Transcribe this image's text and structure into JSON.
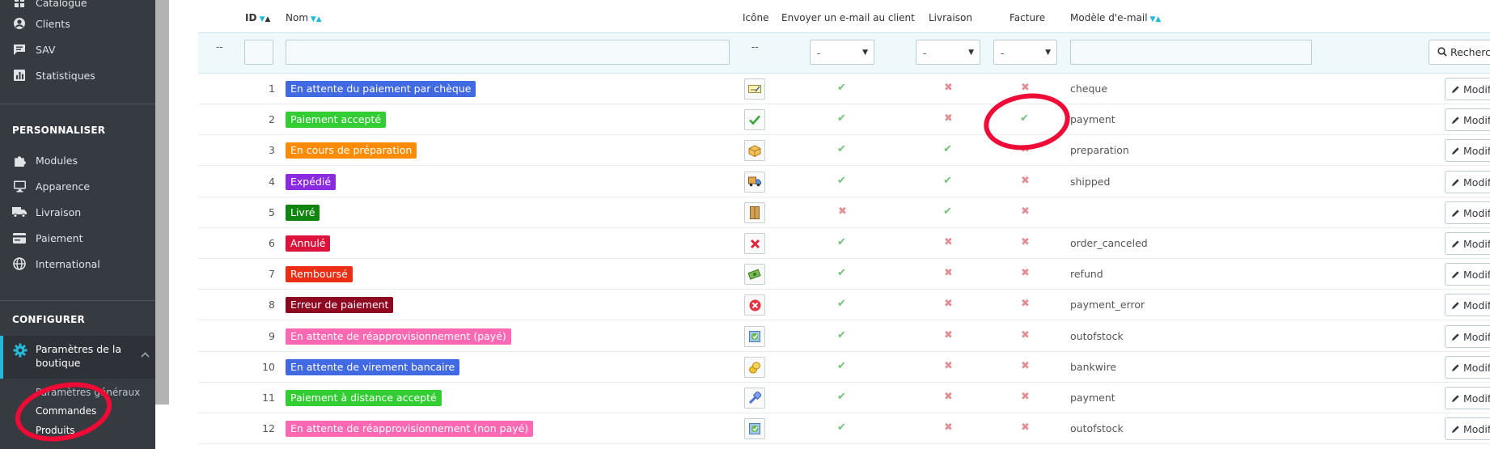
{
  "sidebar": {
    "top_items": [
      {
        "label": "Catalogue",
        "icon": "store-icon"
      },
      {
        "label": "Clients",
        "icon": "user-icon"
      },
      {
        "label": "SAV",
        "icon": "chat-icon"
      },
      {
        "label": "Statistiques",
        "icon": "chart-icon"
      }
    ],
    "section_customize": "PERSONNALISER",
    "customize_items": [
      {
        "label": "Modules",
        "icon": "puzzle-icon"
      },
      {
        "label": "Apparence",
        "icon": "monitor-icon"
      },
      {
        "label": "Livraison",
        "icon": "truck-icon"
      },
      {
        "label": "Paiement",
        "icon": "credit-card-icon"
      },
      {
        "label": "International",
        "icon": "globe-icon"
      }
    ],
    "section_configure": "CONFIGURER",
    "active_item": {
      "label": "Paramètres de la boutique",
      "icon": "gear-icon"
    },
    "sub_items": [
      "Paramètres généraux",
      "Commandes",
      "Produits"
    ]
  },
  "table": {
    "headers": {
      "id": "ID",
      "name": "Nom",
      "icon": "Icône",
      "send_email": "Envoyer un e-mail au client",
      "delivery": "Livraison",
      "invoice": "Facture",
      "template": "Modèle d'e-mail"
    },
    "filter": {
      "dash": "--",
      "select_placeholder": "-",
      "search_label": "Rechercher"
    },
    "edit_label": "Modifier",
    "rows": [
      {
        "id": "1",
        "name": "En attente du paiement par chèque",
        "color": "#4169e1",
        "icon": "cheque-icon",
        "send_email": true,
        "delivery": false,
        "invoice": false,
        "template": "cheque"
      },
      {
        "id": "2",
        "name": "Paiement accepté",
        "color": "#32cd32",
        "icon": "checkmark-icon",
        "send_email": true,
        "delivery": false,
        "invoice": true,
        "template": "payment"
      },
      {
        "id": "3",
        "name": "En cours de préparation",
        "color": "#ff8c00",
        "icon": "box-icon",
        "send_email": true,
        "delivery": true,
        "invoice": false,
        "template": "preparation"
      },
      {
        "id": "4",
        "name": "Expédié",
        "color": "#8a2be2",
        "icon": "truck-icon",
        "send_email": true,
        "delivery": true,
        "invoice": false,
        "template": "shipped"
      },
      {
        "id": "5",
        "name": "Livré",
        "color": "#108510",
        "icon": "package-icon",
        "send_email": false,
        "delivery": true,
        "invoice": false,
        "template": ""
      },
      {
        "id": "6",
        "name": "Annulé",
        "color": "#dc143c",
        "icon": "cancel-icon",
        "send_email": true,
        "delivery": false,
        "invoice": false,
        "template": "order_canceled"
      },
      {
        "id": "7",
        "name": "Remboursé",
        "color": "#ec2e15",
        "icon": "refund-icon",
        "send_email": true,
        "delivery": false,
        "invoice": false,
        "template": "refund"
      },
      {
        "id": "8",
        "name": "Erreur de paiement",
        "color": "#8f0621",
        "icon": "error-icon",
        "send_email": true,
        "delivery": false,
        "invoice": false,
        "template": "payment_error"
      },
      {
        "id": "9",
        "name": "En attente de réapprovisionnement (payé)",
        "color": "#ff69b4",
        "icon": "restock-icon",
        "send_email": true,
        "delivery": false,
        "invoice": false,
        "template": "outofstock"
      },
      {
        "id": "10",
        "name": "En attente de virement bancaire",
        "color": "#4169e1",
        "icon": "coins-icon",
        "send_email": true,
        "delivery": false,
        "invoice": false,
        "template": "bankwire"
      },
      {
        "id": "11",
        "name": "Paiement à distance accepté",
        "color": "#32cd32",
        "icon": "remote-payment-icon",
        "send_email": true,
        "delivery": false,
        "invoice": false,
        "template": "payment"
      },
      {
        "id": "12",
        "name": "En attente de réapprovisionnement (non payé)",
        "color": "#ff69b4",
        "icon": "restock-icon",
        "send_email": true,
        "delivery": false,
        "invoice": false,
        "template": "outofstock"
      }
    ]
  },
  "colors": {
    "accent": "#25b9d7",
    "check": "#72c279",
    "cross": "#e08f95",
    "annotation": "#ee0b36"
  }
}
